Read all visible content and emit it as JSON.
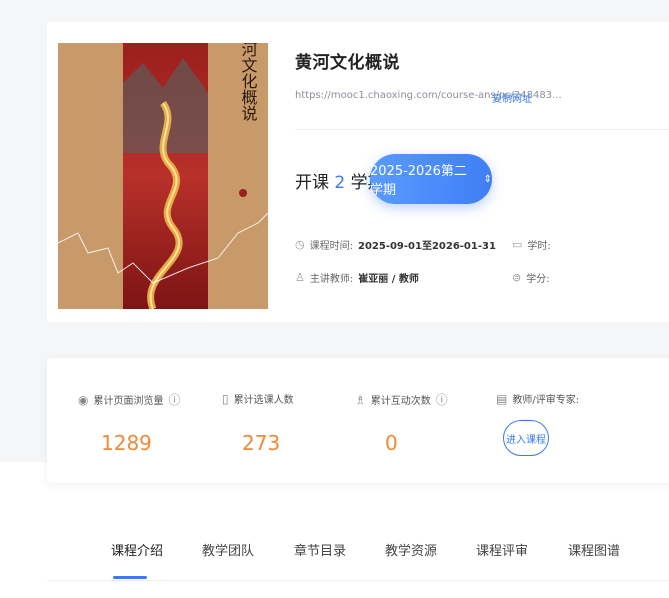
{
  "course": {
    "title": "黄河文化概说",
    "cover_title": "黄河文化概说",
    "url": "https://mooc1.chaoxing.com/course-ans/ps/248483...",
    "copy_label": "复制网址"
  },
  "term": {
    "prefix": "开课",
    "number": "2",
    "suffix": "学期",
    "selected": "2025-2026第二学期",
    "select_icon": "⇕"
  },
  "meta": {
    "time_label": "课程时间:",
    "time_value": "2025-09-01至2026-01-31",
    "teacher_label": "主讲教师:",
    "teacher_value": "崔亚丽 / 教师",
    "hours_label": "学时:",
    "credits_label": "学分:"
  },
  "stats": {
    "views_label": "累计页面浏览量",
    "views_value": "1289",
    "enrolled_label": "累计选课人数",
    "enrolled_value": "273",
    "interactions_label": "累计互动次数",
    "interactions_value": "0",
    "reviewer_label": "教师/评审专家:",
    "enter_label": "进入课程"
  },
  "tabs": [
    "课程介绍",
    "教学团队",
    "章节目录",
    "教学资源",
    "课程评审",
    "课程图谱"
  ],
  "colors": {
    "accent": "#3a7bf2",
    "stat": "#f08a38"
  }
}
